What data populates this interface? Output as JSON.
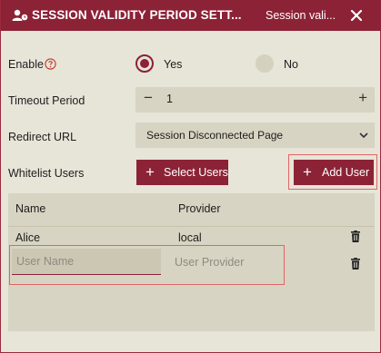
{
  "window": {
    "title": "SESSION VALIDITY PERIOD SETT...",
    "subtitle": "Session vali...",
    "title_icon": "user-clock-icon",
    "close_icon": "close-icon"
  },
  "form": {
    "enable": {
      "label": "Enable",
      "help_icon": "help-circle-icon",
      "options": [
        {
          "label": "Yes",
          "selected": true
        },
        {
          "label": "No",
          "selected": false
        }
      ]
    },
    "timeout": {
      "label": "Timeout Period",
      "value": "1",
      "minus": "−",
      "plus": "+"
    },
    "redirect": {
      "label": "Redirect URL",
      "value": "Session Disconnected Page"
    },
    "whitelist": {
      "label": "Whitelist Users",
      "select_button": "Select Users",
      "add_button": "Add User",
      "plus": "+"
    }
  },
  "users_table": {
    "columns": [
      "Name",
      "Provider"
    ],
    "rows": [
      {
        "name": "Alice",
        "provider": "local"
      }
    ],
    "new_row": {
      "name_placeholder": "User Name",
      "provider_placeholder": "User Provider",
      "name_value": "",
      "provider_value": ""
    }
  },
  "colors": {
    "accent": "#8c2236",
    "background": "#e7e4d8",
    "field": "#d8d4c3",
    "highlight": "#e06666"
  }
}
